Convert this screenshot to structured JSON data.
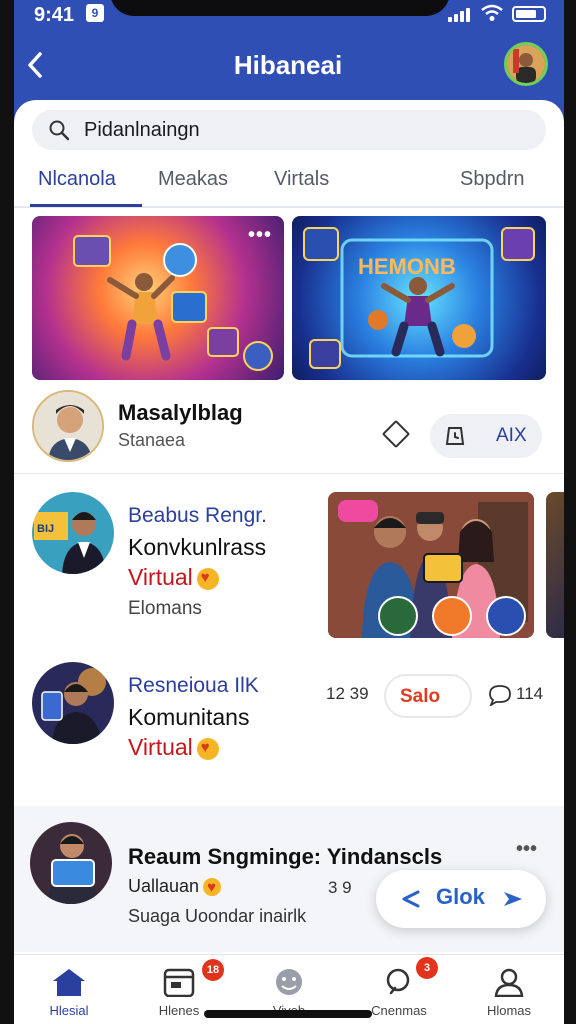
{
  "status_bar": {
    "time": "9:41",
    "sim_label": "9"
  },
  "header": {
    "title": "Hibaneai",
    "back_icon": "chevron-left-icon"
  },
  "search": {
    "value": "Pidanlnaingn"
  },
  "tabs": [
    {
      "label": "Nlcanola",
      "active": true
    },
    {
      "label": "Meakas",
      "active": false
    },
    {
      "label": "Virtals",
      "active": false
    },
    {
      "label": "Sbpdrn",
      "active": false
    }
  ],
  "profile": {
    "name": "Masalylblag",
    "subtitle": "Stanaea",
    "pill_label": "AIX"
  },
  "feed": [
    {
      "line1": "Beabus Rengr.",
      "line2": "Konvkunlrass",
      "line3": "Virtual",
      "line4": "Elomans",
      "thumb_label": "BIJ"
    },
    {
      "line1": "Resneioua IlK",
      "line2": "Komunitans",
      "line3": "Virtual",
      "meta": "12 39",
      "button": "Salo",
      "comments": "114"
    },
    {
      "title": "Reaum Sngminge: Yindanscls",
      "line2": "Uallauan",
      "meta": "3 9",
      "line3": "Suaga Uoondar inairlk",
      "share_label": "Glok"
    }
  ],
  "bottom_nav": [
    {
      "label": "Hlesial",
      "icon": "home-icon",
      "active": true,
      "badge": ""
    },
    {
      "label": "Hlenes",
      "icon": "calendar-icon",
      "active": false,
      "badge": "18"
    },
    {
      "label": "Viveb",
      "icon": "face-icon",
      "active": false,
      "badge": ""
    },
    {
      "label": "Cnenmas",
      "icon": "search-icon",
      "active": false,
      "badge": "3"
    },
    {
      "label": "Hlomas",
      "icon": "profile-icon",
      "active": false,
      "badge": ""
    }
  ],
  "colors": {
    "brand": "#2f4fb5",
    "accent": "#2a3f9e",
    "alert": "#e2341c",
    "virtual_red": "#c4161c"
  }
}
